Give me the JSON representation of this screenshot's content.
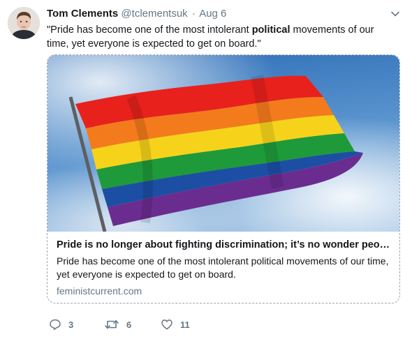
{
  "tweet": {
    "author_name": "Tom Clements",
    "author_handle": "@tclementsuk",
    "separator": "·",
    "date": "Aug 6",
    "text_before": "\"Pride has become one of the most intolerant ",
    "text_bold": "political",
    "text_after": " movements of our time, yet everyone is expected to get on board.\""
  },
  "card": {
    "title": "Pride is no longer about fighting discrimination; it’s no wonder peopl…",
    "description": "Pride has become one of the most intolerant political movements of our time, yet everyone is expected to get on board.",
    "domain": "feministcurrent.com"
  },
  "actions": {
    "reply_count": "3",
    "retweet_count": "6",
    "like_count": "11"
  },
  "icons": {
    "caret": "chevron-down-icon",
    "reply": "reply-icon",
    "retweet": "retweet-icon",
    "like": "heart-icon"
  },
  "colors": {
    "secondary_text": "#657786",
    "primary_text": "#14171a",
    "card_border": "#9aa5b1"
  }
}
